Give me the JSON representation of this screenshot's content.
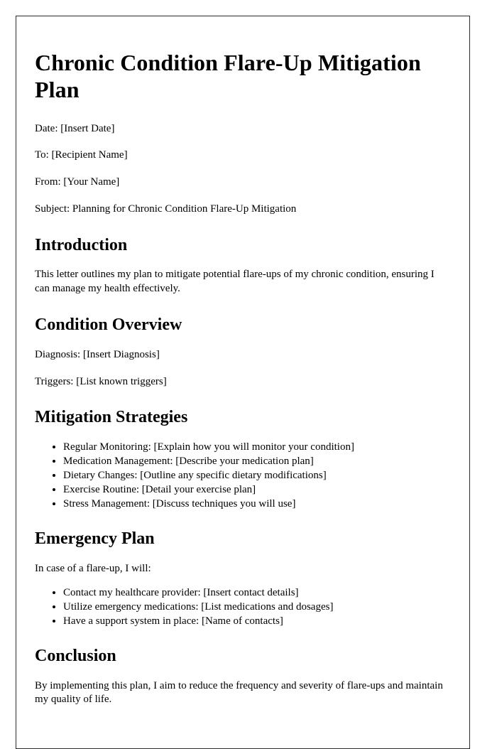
{
  "document": {
    "title": "Chronic Condition Flare-Up Mitigation Plan",
    "header": {
      "date_line": "Date: [Insert Date]",
      "to_line": "To: [Recipient Name]",
      "from_line": "From: [Your Name]",
      "subject_line": "Subject: Planning for Chronic Condition Flare-Up Mitigation"
    },
    "sections": {
      "introduction": {
        "heading": "Introduction",
        "paragraph": "This letter outlines my plan to mitigate potential flare-ups of my chronic condition, ensuring I can manage my health effectively."
      },
      "condition_overview": {
        "heading": "Condition Overview",
        "diagnosis_line": "Diagnosis: [Insert Diagnosis]",
        "triggers_line": "Triggers: [List known triggers]"
      },
      "mitigation_strategies": {
        "heading": "Mitigation Strategies",
        "items": [
          "Regular Monitoring: [Explain how you will monitor your condition]",
          "Medication Management: [Describe your medication plan]",
          "Dietary Changes: [Outline any specific dietary modifications]",
          "Exercise Routine: [Detail your exercise plan]",
          "Stress Management: [Discuss techniques you will use]"
        ]
      },
      "emergency_plan": {
        "heading": "Emergency Plan",
        "intro": "In case of a flare-up, I will:",
        "items": [
          "Contact my healthcare provider: [Insert contact details]",
          "Utilize emergency medications: [List medications and dosages]",
          "Have a support system in place: [Name of contacts]"
        ]
      },
      "conclusion": {
        "heading": "Conclusion",
        "paragraph": "By implementing this plan, I aim to reduce the frequency and severity of flare-ups and maintain my quality of life."
      }
    }
  }
}
